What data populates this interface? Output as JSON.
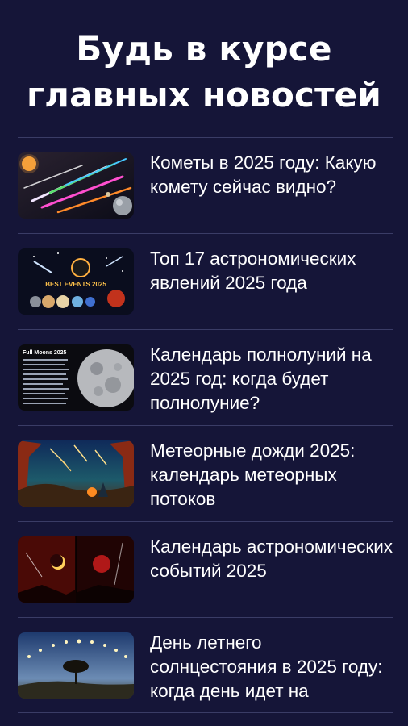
{
  "header": {
    "title_line1": "Будь в курсе",
    "title_line2": "главных новостей"
  },
  "articles": [
    {
      "title": "Кометы в 2025 году: Какую комету сейчас видно?",
      "thumb_icon": "comets-thumbnail"
    },
    {
      "title": "Топ 17 астрономических явлений 2025 года",
      "thumb_icon": "best-events-thumbnail",
      "thumb_caption": "BEST EVENTS 2025"
    },
    {
      "title": "Календарь полнолуний на 2025 год: когда будет полнолуние?",
      "thumb_icon": "full-moons-thumbnail",
      "thumb_caption": "Full Moons 2025"
    },
    {
      "title": "Метеорные дожди 2025: календарь метеорных потоков",
      "thumb_icon": "meteor-showers-thumbnail"
    },
    {
      "title": "Календарь астрономических событий 2025",
      "thumb_icon": "eclipse-thumbnail"
    },
    {
      "title": "День летнего солнцестояния в 2025 году: когда день идет на",
      "thumb_icon": "solstice-thumbnail"
    }
  ]
}
